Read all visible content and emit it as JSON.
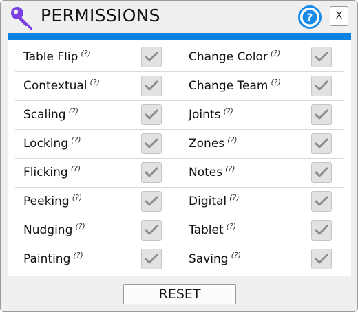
{
  "window": {
    "title": "PERMISSIONS",
    "close_label": "X",
    "accent_color": "#0a84e0",
    "help_icon": "help-circle-icon",
    "title_icon": "key-icon"
  },
  "hint_marker": "(?)",
  "permissions": {
    "left": [
      {
        "label": "Table Flip",
        "checked": true
      },
      {
        "label": "Contextual",
        "checked": true
      },
      {
        "label": "Scaling",
        "checked": true
      },
      {
        "label": "Locking",
        "checked": true
      },
      {
        "label": "Flicking",
        "checked": true
      },
      {
        "label": "Peeking",
        "checked": true
      },
      {
        "label": "Nudging",
        "checked": true
      },
      {
        "label": "Painting",
        "checked": true
      }
    ],
    "right": [
      {
        "label": "Change Color",
        "checked": true
      },
      {
        "label": "Change Team",
        "checked": true
      },
      {
        "label": "Joints",
        "checked": true
      },
      {
        "label": "Zones",
        "checked": true
      },
      {
        "label": "Notes",
        "checked": true
      },
      {
        "label": "Digital",
        "checked": true
      },
      {
        "label": "Tablet",
        "checked": true
      },
      {
        "label": "Saving",
        "checked": true
      }
    ]
  },
  "reset_label": "RESET"
}
